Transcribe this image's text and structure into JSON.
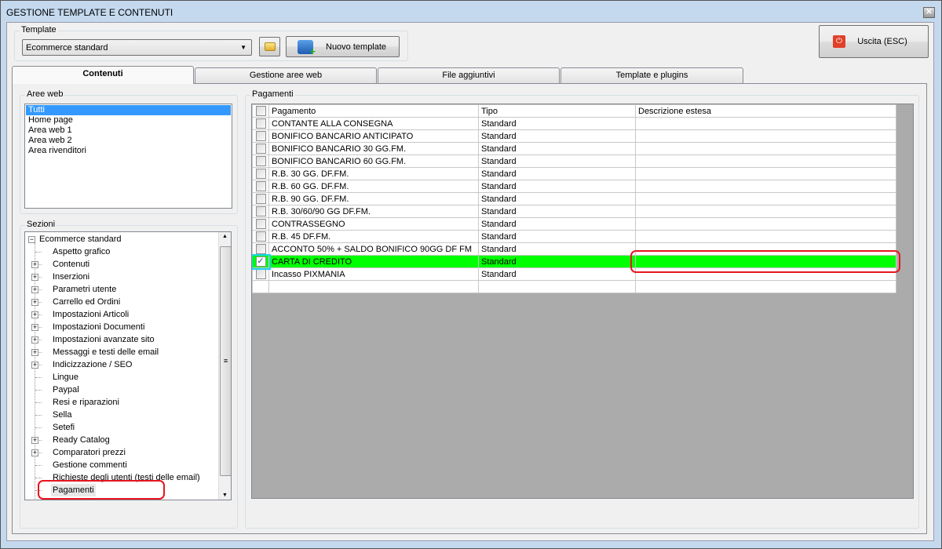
{
  "window": {
    "title": "GESTIONE TEMPLATE E CONTENUTI"
  },
  "template": {
    "label": "Template",
    "selected": "Ecommerce standard",
    "new_label": "Nuovo template"
  },
  "exit": {
    "label": "Uscita (ESC)"
  },
  "tabs": [
    {
      "label": "Contenuti",
      "selected": true
    },
    {
      "label": "Gestione aree web"
    },
    {
      "label": "File aggiuntivi"
    },
    {
      "label": "Template e plugins"
    }
  ],
  "aree_web": {
    "label": "Aree web",
    "items": [
      "Tutti",
      "Home page",
      "Area web 1",
      "Area web 2",
      "Area rivenditori"
    ],
    "selected_index": 0
  },
  "sezioni": {
    "label": "Sezioni",
    "root": "Ecommerce standard",
    "items": [
      {
        "label": "Aspetto grafico",
        "expandable": false
      },
      {
        "label": "Contenuti",
        "expandable": true
      },
      {
        "label": "Inserzioni",
        "expandable": true
      },
      {
        "label": "Parametri utente",
        "expandable": true
      },
      {
        "label": "Carrello ed Ordini",
        "expandable": true
      },
      {
        "label": "Impostazioni Articoli",
        "expandable": true
      },
      {
        "label": "Impostazioni Documenti",
        "expandable": true
      },
      {
        "label": "Impostazioni avanzate sito",
        "expandable": true
      },
      {
        "label": "Messaggi e testi delle email",
        "expandable": true
      },
      {
        "label": "Indicizzazione / SEO",
        "expandable": true
      },
      {
        "label": "Lingue",
        "expandable": false
      },
      {
        "label": "Paypal",
        "expandable": false
      },
      {
        "label": "Resi e riparazioni",
        "expandable": false
      },
      {
        "label": "Sella",
        "expandable": false
      },
      {
        "label": "Setefi",
        "expandable": false
      },
      {
        "label": "Ready Catalog",
        "expandable": true
      },
      {
        "label": "Comparatori prezzi",
        "expandable": true
      },
      {
        "label": "Gestione commenti",
        "expandable": false
      },
      {
        "label": "Richieste degli utenti (testi delle email)",
        "expandable": false
      },
      {
        "label": "Pagamenti",
        "expandable": false,
        "selected": true
      }
    ]
  },
  "pagamenti": {
    "label": "Pagamenti",
    "columns": [
      "Pagamento",
      "Tipo",
      "Descrizione estesa"
    ],
    "rows": [
      {
        "name": "CONTANTE ALLA CONSEGNA",
        "tipo": "Standard",
        "desc": "",
        "checked": false
      },
      {
        "name": "BONIFICO BANCARIO ANTICIPATO",
        "tipo": "Standard",
        "desc": "",
        "checked": false
      },
      {
        "name": "BONIFICO BANCARIO 30 GG.FM.",
        "tipo": "Standard",
        "desc": "",
        "checked": false
      },
      {
        "name": "BONIFICO BANCARIO 60 GG.FM.",
        "tipo": "Standard",
        "desc": "",
        "checked": false
      },
      {
        "name": "R.B. 30 GG. DF.FM.",
        "tipo": "Standard",
        "desc": "",
        "checked": false
      },
      {
        "name": "R.B. 60 GG. DF.FM.",
        "tipo": "Standard",
        "desc": "",
        "checked": false
      },
      {
        "name": "R.B. 90 GG. DF.FM.",
        "tipo": "Standard",
        "desc": "",
        "checked": false
      },
      {
        "name": "R.B. 30/60/90 GG DF.FM.",
        "tipo": "Standard",
        "desc": "",
        "checked": false
      },
      {
        "name": "CONTRASSEGNO",
        "tipo": "Standard",
        "desc": "",
        "checked": false
      },
      {
        "name": "R.B. 45 DF.FM.",
        "tipo": "Standard",
        "desc": "",
        "checked": false
      },
      {
        "name": "ACCONTO 50% + SALDO BONIFICO 90GG DF FM",
        "tipo": "Standard",
        "desc": "",
        "checked": false
      },
      {
        "name": "CARTA DI CREDITO",
        "tipo": "Standard",
        "desc": "",
        "checked": true,
        "highlighted": true
      },
      {
        "name": "Incasso PIXMANIA",
        "tipo": "Standard",
        "desc": "",
        "checked": false
      }
    ]
  },
  "colors": {
    "highlight": "#00ff00",
    "selection": "#3399ff",
    "annotation": "#e8141e"
  }
}
